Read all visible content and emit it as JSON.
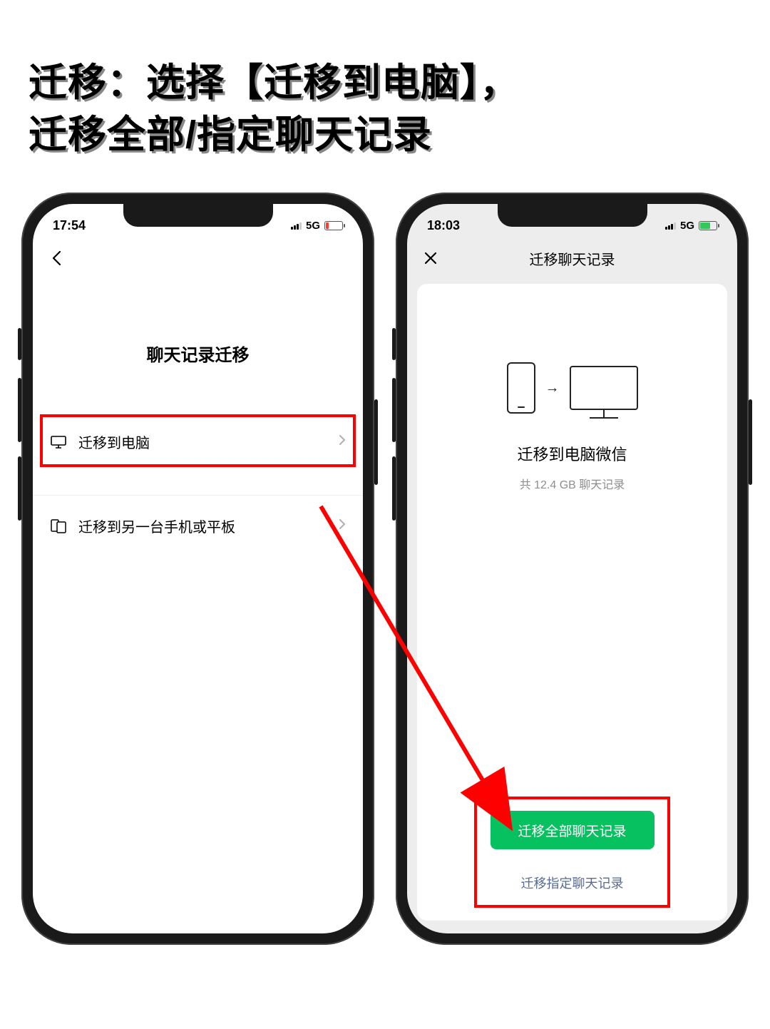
{
  "headline": "迁移：选择【迁移到电脑】，\n            迁移全部/指定聊天记录",
  "phone1": {
    "time": "17:54",
    "network": "5G",
    "page_title": "聊天记录迁移",
    "menu": [
      {
        "label": "迁移到电脑"
      },
      {
        "label": "迁移到另一台手机或平板"
      }
    ]
  },
  "phone2": {
    "time": "18:03",
    "network": "5G",
    "nav_title": "迁移聊天记录",
    "card_title": "迁移到电脑微信",
    "card_subtitle": "共 12.4 GB 聊天记录",
    "primary_button": "迁移全部聊天记录",
    "link_button": "迁移指定聊天记录"
  }
}
